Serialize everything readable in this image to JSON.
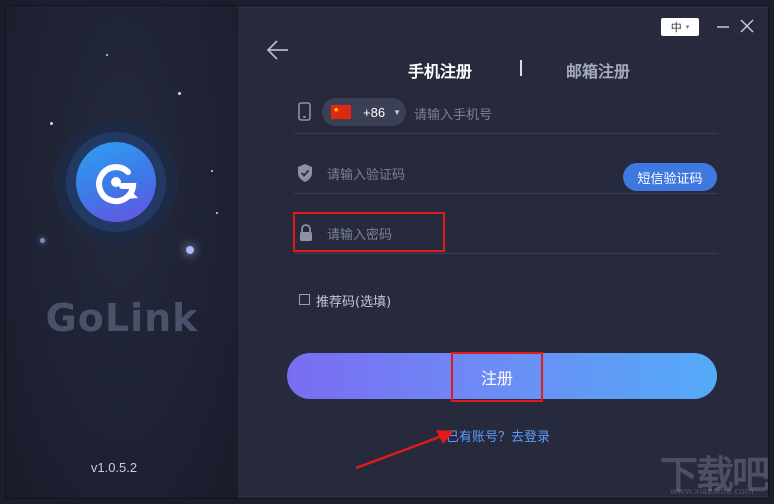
{
  "window": {
    "language": "中",
    "language_caret": "▾",
    "minimize_icon": "minimize-icon",
    "close_icon": "close-icon"
  },
  "brand": {
    "name": "GoLink",
    "version": "v1.0.5.2",
    "logo_icon": "golink-logo-icon"
  },
  "tabs": [
    {
      "label": "手机注册",
      "active": true
    },
    {
      "label": "邮箱注册",
      "active": false
    }
  ],
  "form": {
    "phone": {
      "country_code": "+86",
      "country_flag": "china-flag-icon",
      "placeholder": "请输入手机号"
    },
    "verification": {
      "placeholder": "请输入验证码",
      "sms_button_label": "短信验证码"
    },
    "password": {
      "placeholder": "请输入密码"
    },
    "referral": {
      "label": "推荐码(选填)",
      "checked": false
    },
    "submit_label": "注册",
    "login_link": "已有账号？去登录"
  },
  "watermark": {
    "big": "下载吧",
    "small": "www.xiazaiba.com"
  },
  "colors": {
    "background": "#262a3c",
    "accent": "#3f79e0",
    "link": "#5a9cff",
    "highlight": "#e11b1b"
  }
}
